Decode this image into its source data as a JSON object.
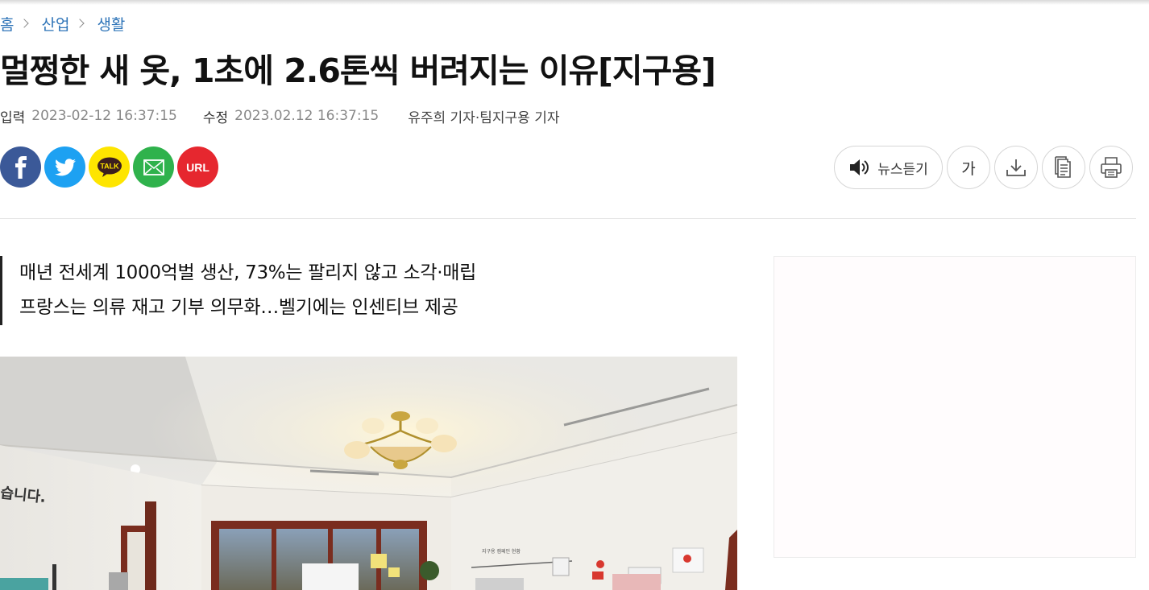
{
  "breadcrumb": [
    {
      "label": "홈"
    },
    {
      "label": "산업"
    },
    {
      "label": "생활"
    }
  ],
  "article": {
    "title": "멀쩡한 새 옷, 1초에 2.6톤씩 버려지는 이유[지구용]",
    "published_label": "입력",
    "published_value": "2023-02-12 16:37:15",
    "modified_label": "수정",
    "modified_value": "2023.02.12 16:37:15",
    "author": "유주희 기자·팀지구용 기자",
    "subheads": [
      "매년 전세계 1000억벌 생산, 73%는 팔리지 않고 소각·매립",
      "프랑스는 의류 재고 기부 의무화…벨기에는 인센티브 제공"
    ]
  },
  "share": {
    "url_label": "URL",
    "kakao_label": "TALK"
  },
  "tools": {
    "tts_label": "뉴스듣기",
    "font_label": "가"
  },
  "colors": {
    "facebook": "#3b5998",
    "twitter": "#1da1f2",
    "kakao": "#fee500",
    "email": "#2fb24c",
    "url": "#e6272f",
    "breadcrumb": "#2e74b8"
  }
}
